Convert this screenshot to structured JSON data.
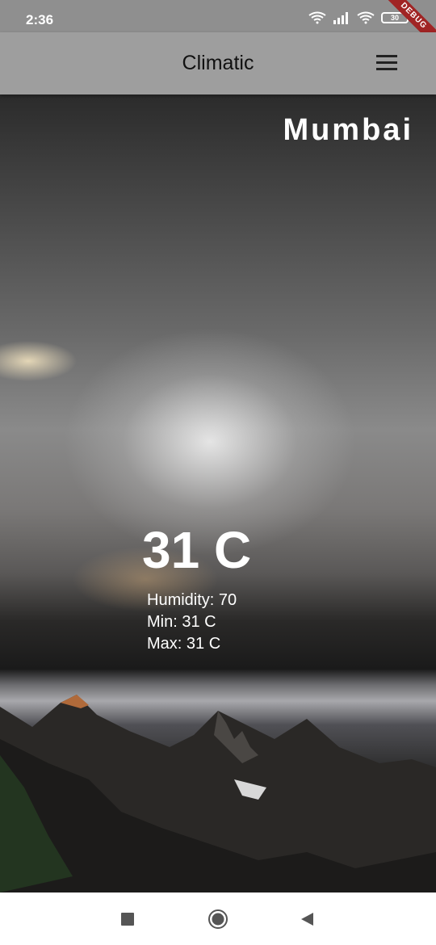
{
  "status_bar": {
    "time": "2:36",
    "battery_level": "30",
    "debug_label": "DEBUG",
    "icons": [
      "wifi-signal-icon",
      "cell-signal-icon",
      "wifi-icon",
      "battery-icon"
    ]
  },
  "app_bar": {
    "title": "Climatic",
    "menu_icon": "hamburger-menu-icon"
  },
  "weather": {
    "city": "Mumbai",
    "temperature": "31 C",
    "humidity": "Humidity: 70",
    "min": "Min: 31 C",
    "max": "Max: 31 C"
  },
  "nav_bar": {
    "icons": [
      "recents-square-icon",
      "home-circle-icon",
      "back-triangle-icon"
    ]
  },
  "colors": {
    "status_bar_bg": "#8f8f8f",
    "app_bar_bg": "#9e9e9e",
    "text_light": "#ffffff",
    "debug_ribbon": "#a02424"
  }
}
